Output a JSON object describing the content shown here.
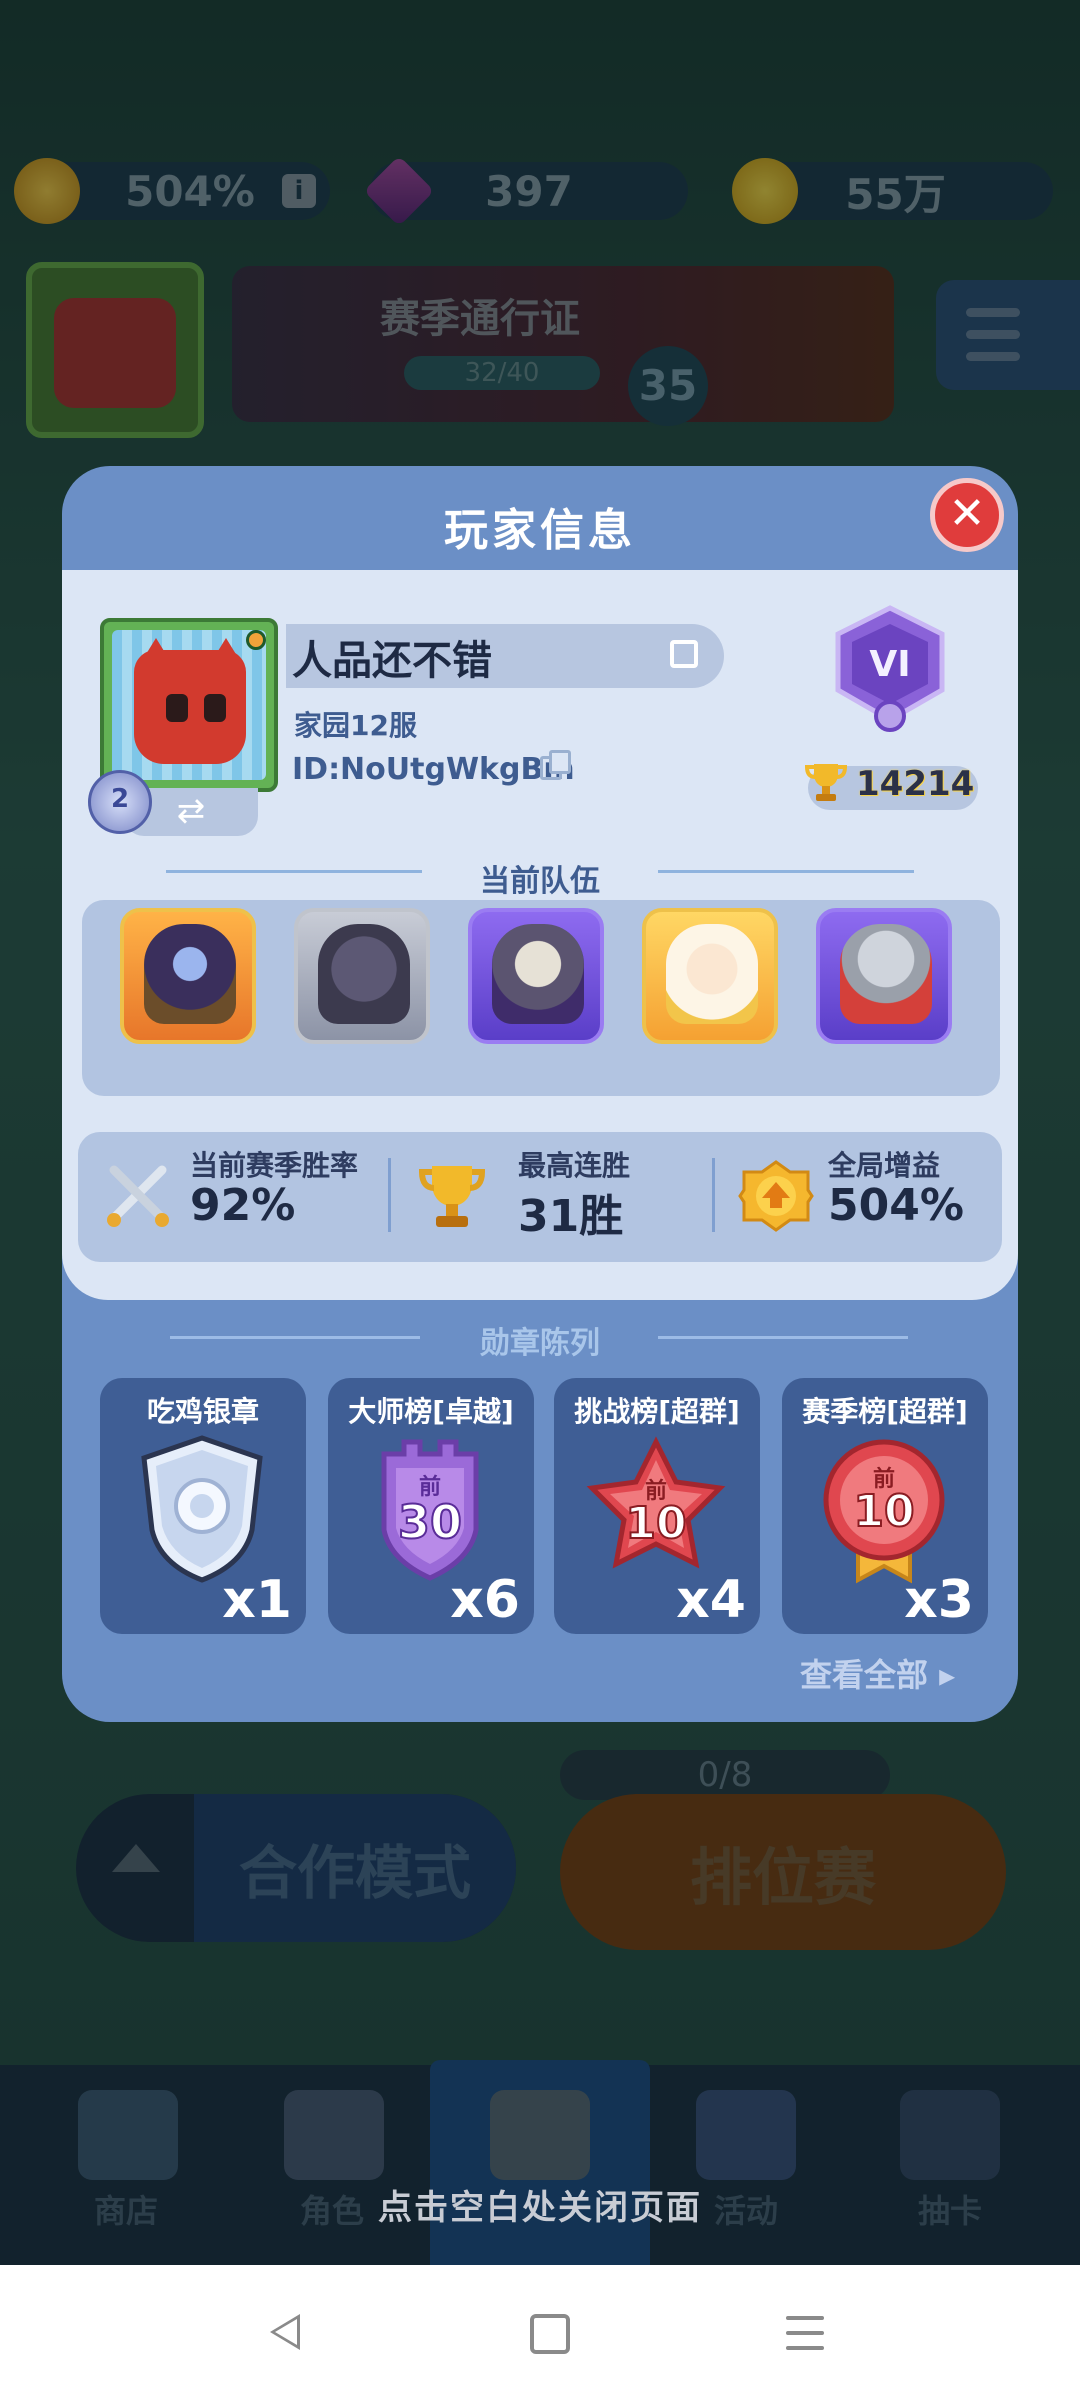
{
  "background": {
    "resources": {
      "boost": "504%",
      "gems": "397",
      "coins": "55万"
    },
    "season_pass": {
      "title": "赛季通行证",
      "progress": "32/40",
      "level": "35"
    },
    "modes": {
      "coop": "合作模式",
      "ranked": "排位赛",
      "ranked_count": "0/8"
    },
    "nav": [
      "商店",
      "角色",
      "",
      "活动",
      "抽卡"
    ]
  },
  "modal": {
    "title": "玩家信息",
    "player": {
      "name": "人品还不错",
      "server": "家园12服",
      "id": "ID:NoUtgWkgBm",
      "level": "2",
      "rank": "VI",
      "trophies": "14214"
    },
    "team_title": "当前队伍",
    "stats": [
      {
        "label": "当前赛季胜率",
        "value": "92%",
        "icon": "crossed-swords-icon"
      },
      {
        "label": "最高连胜",
        "value": "31胜",
        "icon": "trophy-icon"
      },
      {
        "label": "全局增益",
        "value": "504%",
        "icon": "boost-icon"
      }
    ],
    "medal_title": "勋章陈列",
    "medals": [
      {
        "title": "吃鸡银章",
        "count": "x1",
        "icon": "silver-shield-medal-icon"
      },
      {
        "title": "大师榜[卓越]",
        "count": "x6",
        "icon": "purple-top30-medal-icon",
        "badge_top": "前",
        "badge_num": "30"
      },
      {
        "title": "挑战榜[超群]",
        "count": "x4",
        "icon": "red-star-top10-medal-icon",
        "badge_top": "前",
        "badge_num": "10"
      },
      {
        "title": "赛季榜[超群]",
        "count": "x3",
        "icon": "red-ribbon-top10-medal-icon",
        "badge_top": "前",
        "badge_num": "10"
      }
    ],
    "view_all": "查看全部 ▸"
  },
  "close_hint": "点击空白处关闭页面",
  "colors": {
    "modal": "#6b8fc6",
    "panel": "#dce6f5",
    "close": "#e03c3c"
  }
}
